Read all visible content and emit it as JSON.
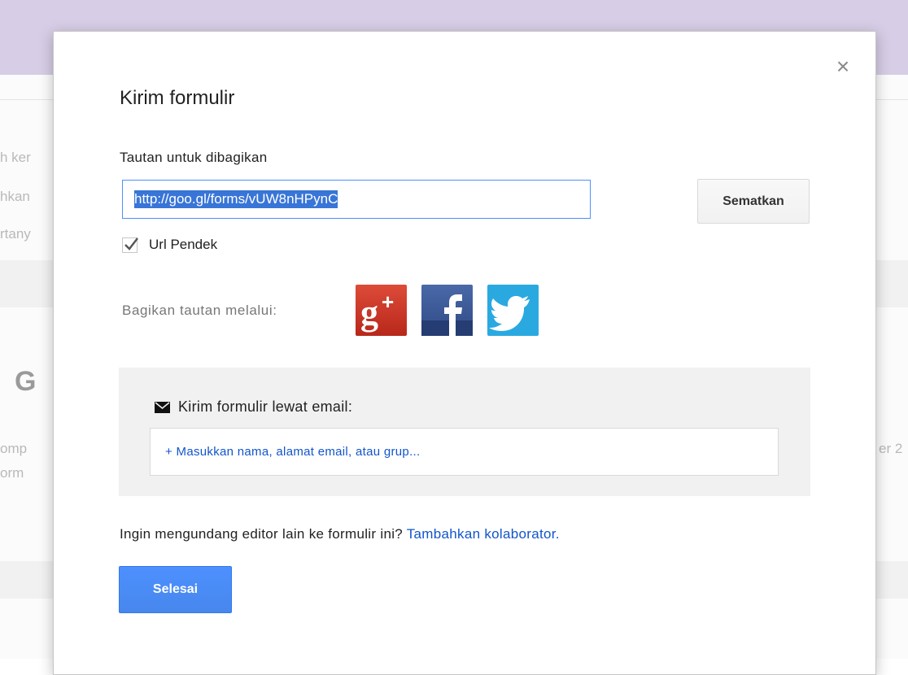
{
  "background": {
    "fragments": [
      "h ker",
      "hkan",
      "rtany",
      "omp",
      "orm",
      "er 2"
    ],
    "heading_fragment": "G"
  },
  "dialog": {
    "title": "Kirim formulir",
    "close_symbol": "×",
    "link_label": "Tautan untuk dibagikan",
    "link_value": "http://goo.gl/forms/vUW8nHPynC",
    "embed_label": "Sematkan",
    "short_url": {
      "label": "Url Pendek",
      "checked": true
    },
    "share_label": "Bagikan tautan melalui:",
    "share_icons": [
      "google-plus-icon",
      "facebook-icon",
      "twitter-icon"
    ],
    "email": {
      "label": "Kirim formulir lewat email:",
      "placeholder": "+ Masukkan nama, alamat email, atau grup..."
    },
    "invite_text": "Ingin mengundang editor lain ke formulir ini? ",
    "invite_link": "Tambahkan kolaborator.",
    "done_label": "Selesai"
  },
  "colors": {
    "accent": "#4d90fe",
    "link": "#1155cc",
    "header_band": "#d7cde6"
  }
}
